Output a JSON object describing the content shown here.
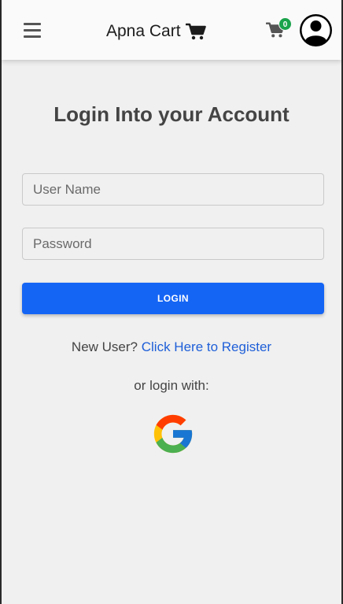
{
  "header": {
    "brand": "Apna Cart",
    "cart_count": "0"
  },
  "login": {
    "title": "Login Into your Account",
    "username_placeholder": "User Name",
    "username_value": "",
    "password_placeholder": "Password",
    "password_value": "",
    "login_label": "LOGIN",
    "new_user_text": "New User?",
    "register_link": "Click Here to Register",
    "or_login_with": "or login with:"
  },
  "icons": {
    "menu": "hamburger-menu-icon",
    "brand_cart": "shopping-cart-icon",
    "cart": "shopping-cart-icon",
    "avatar": "user-avatar-icon",
    "google": "google-logo-icon"
  },
  "colors": {
    "primary": "#1565f5",
    "link": "#1e5fd8",
    "badge": "#1aa34a",
    "background": "#f0f0f0",
    "header_bg": "#fafafa"
  }
}
